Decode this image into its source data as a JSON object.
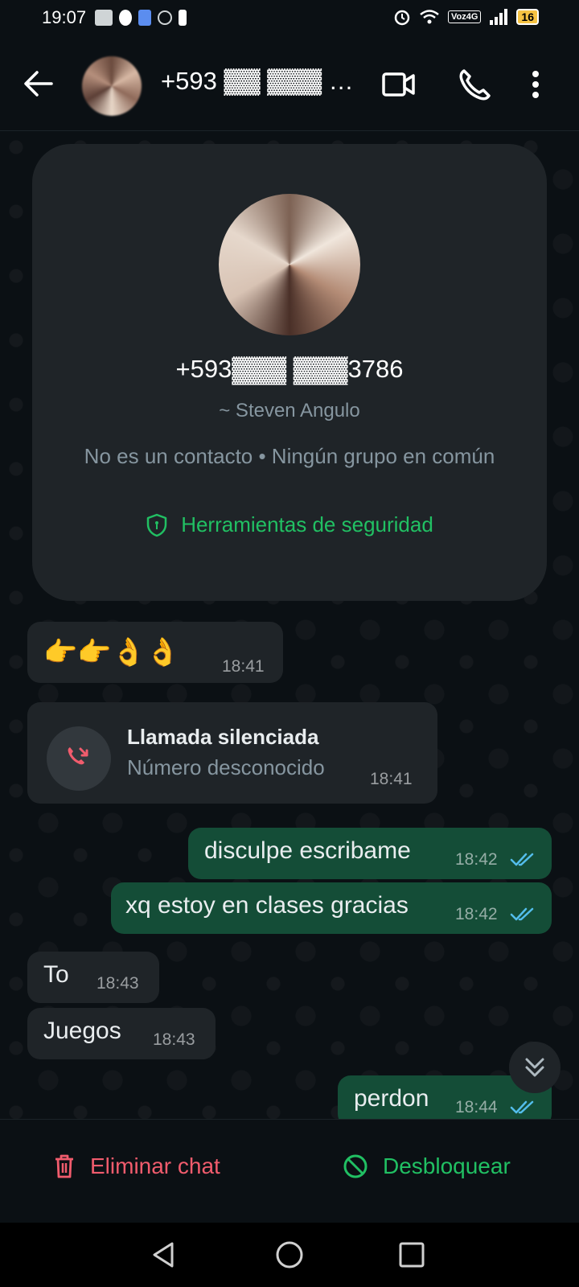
{
  "status_bar": {
    "time": "19:07",
    "network_label": "Voz4G",
    "battery": "16"
  },
  "header": {
    "title": "+593 ▓▓ ▓▓▓ 3…",
    "icons": [
      "back-arrow-icon",
      "video-call-icon",
      "voice-call-icon",
      "more-vert-icon"
    ]
  },
  "contact_card": {
    "phone": "+593▓▓▓ ▓▓▓3786",
    "name": "~ Steven Angulo",
    "description": "No es un contacto • Ningún grupo en común",
    "security_label": "Herramientas de seguridad",
    "accent": "#21c063"
  },
  "messages": [
    {
      "direction": "in",
      "text": "👉👉👌👌",
      "time": "18:41"
    },
    {
      "direction": "in",
      "type": "call",
      "title": "Llamada silenciada",
      "subtitle": "Número desconocido",
      "time": "18:41"
    },
    {
      "direction": "out",
      "text": "disculpe escribame",
      "time": "18:42",
      "status": "read"
    },
    {
      "direction": "out",
      "text": "xq estoy en clases gracias",
      "time": "18:42",
      "status": "read"
    },
    {
      "direction": "in",
      "text": "To",
      "time": "18:43"
    },
    {
      "direction": "in",
      "text": "Juegos",
      "time": "18:43"
    },
    {
      "direction": "out",
      "text": "perdon",
      "time": "18:44",
      "status": "read"
    }
  ],
  "bottom_bar": {
    "delete_label": "Eliminar chat",
    "unblock_label": "Desbloquear",
    "delete_color": "#f15c6d",
    "unblock_color": "#21c063"
  },
  "colors": {
    "background": "#0b1014",
    "incoming_bubble": "#1f2428",
    "outgoing_bubble": "#144d37",
    "read_ticks": "#53bdeb"
  }
}
